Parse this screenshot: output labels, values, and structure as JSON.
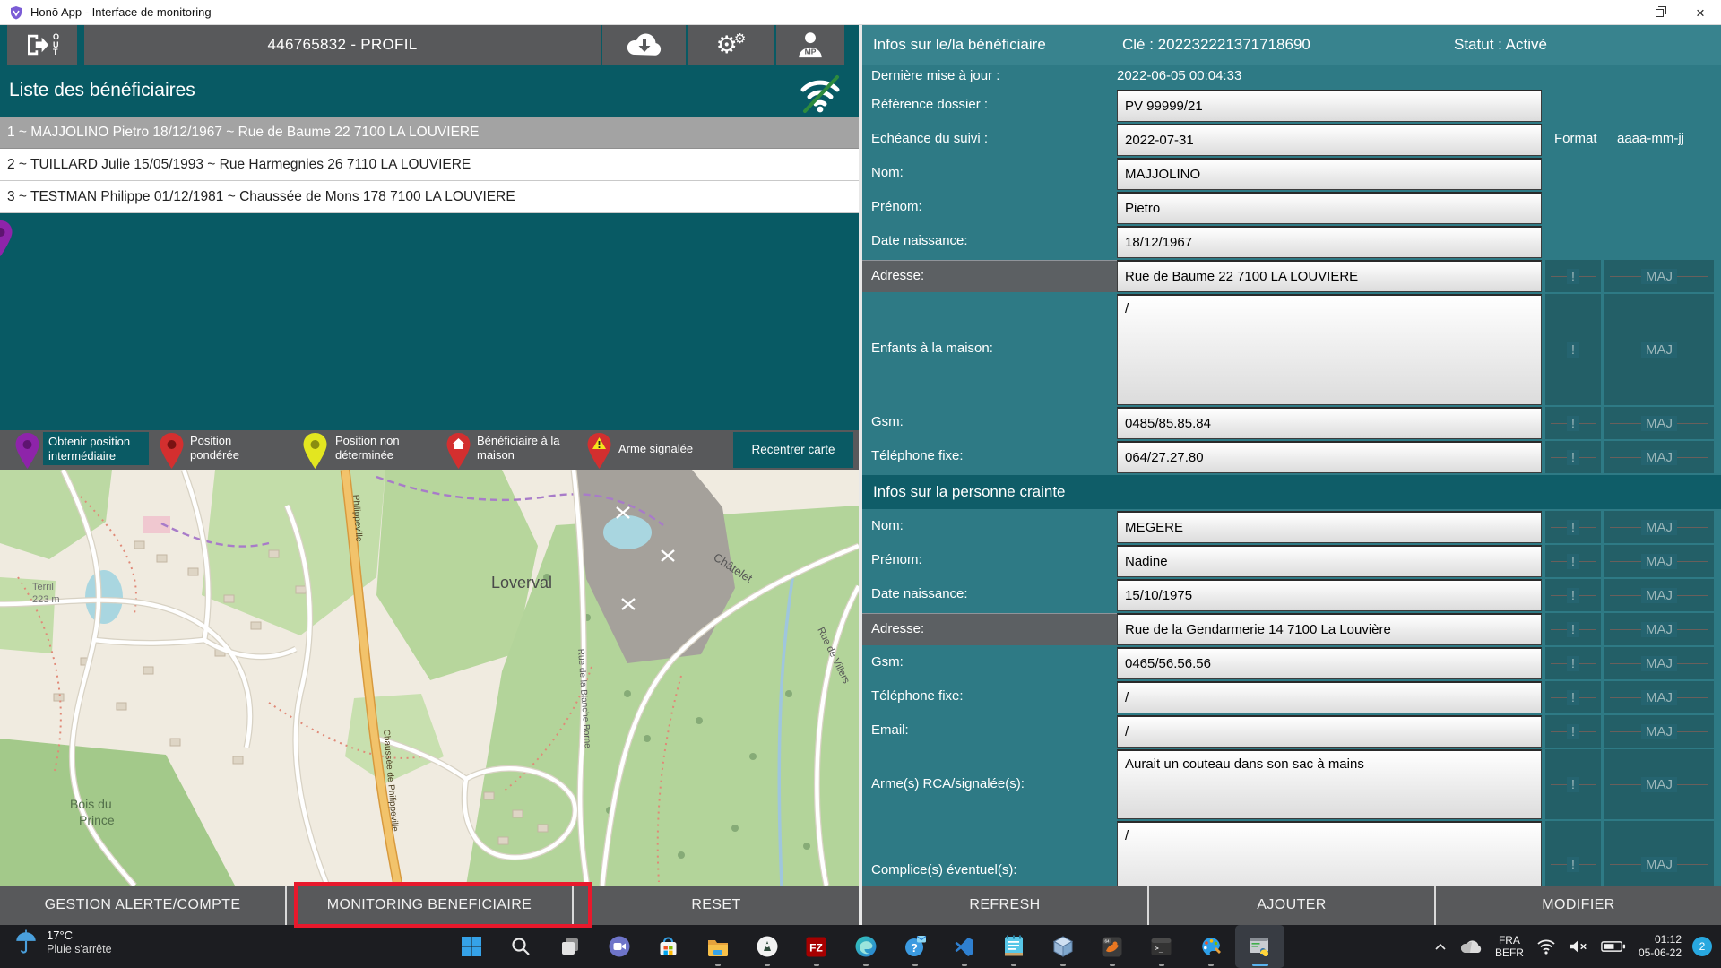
{
  "window": {
    "title": "Honō App - Interface de monitoring"
  },
  "toolbar": {
    "out_label": "OUT",
    "profile_label": "446765832 - PROFIL",
    "person_badge": "MP",
    "icons": [
      "logout-icon",
      "cloud-download-icon",
      "settings-gears-icon",
      "user-mp-icon",
      "wifi-ok-icon"
    ]
  },
  "beneficiaries": {
    "header": "Liste des bénéficiaires",
    "items": [
      "1 ~ MAJJOLINO Pietro 18/12/1967 ~ Rue de Baume 22 7100 LA LOUVIERE",
      "2 ~ TUILLARD Julie 15/05/1993 ~ Rue Harmegnies 26 7110 LA LOUVIERE",
      "3 ~ TESTMAN Philippe 01/12/1981 ~ Chaussée de Mons 178 7100 LA LOUVIERE"
    ]
  },
  "legend": {
    "items": [
      {
        "label": "Obtenir position intermédiaire",
        "pin_color": "#8e24aa"
      },
      {
        "label": "Position pondérée",
        "pin_color": "#d32f2f"
      },
      {
        "label": "Position non déterminée",
        "pin_color": "#e3e620"
      },
      {
        "label": "Bénéficiaire à la maison",
        "pin_color": "#d32f2f"
      },
      {
        "label": "Arme signalée",
        "pin_color": "#d32f2f"
      }
    ],
    "recenter_label": "Recentrer carte"
  },
  "map": {
    "labels": {
      "terril_1": "Terril",
      "terril_2": "223 m",
      "loverval": "Loverval",
      "chatelet": "Châtelet",
      "rue_villers": "Rue de Villers",
      "rue_blanche": "Rue de la Blanche Borne",
      "philippeville": "Philippeville",
      "chaussee": "Chaussée de Philippeville",
      "bois_1": "Bois du",
      "bois_2": "Prince"
    }
  },
  "left_buttons": [
    "GESTION ALERTE/COMPTE",
    "MONITORING BENEFICIAIRE",
    "RESET"
  ],
  "right_buttons": [
    "REFRESH",
    "AJOUTER",
    "MODIFIER"
  ],
  "maj": {
    "alert": "!",
    "update": "MAJ"
  },
  "beneficiary_info": {
    "title": "Infos sur le/la bénéficiaire",
    "key_label": "Clé : 202232221371718690",
    "status_label": "Statut : Activé",
    "format_label": "Format",
    "format_value": "aaaa-mm-jj",
    "rows": [
      {
        "label": "Dernière mise à jour :",
        "value": "2022-06-05 00:04:33"
      },
      {
        "label": "Référence dossier :",
        "value": "PV 99999/21"
      },
      {
        "label": "Echéance du suivi :",
        "value": "2022-07-31"
      },
      {
        "label": "Nom:",
        "value": "MAJJOLINO"
      },
      {
        "label": "Prénom:",
        "value": "Pietro"
      },
      {
        "label": "Date naissance:",
        "value": "18/12/1967"
      },
      {
        "label": "Adresse:",
        "value": "Rue de Baume 22 7100 LA LOUVIERE"
      },
      {
        "label": "Enfants à la maison:",
        "value": "/"
      },
      {
        "label": "Gsm:",
        "value": "0485/85.85.84"
      },
      {
        "label": "Téléphone fixe:",
        "value": "064/27.27.80"
      }
    ]
  },
  "feared_person": {
    "title": "Infos sur la personne crainte",
    "rows": [
      {
        "label": "Nom:",
        "value": "MEGERE"
      },
      {
        "label": "Prénom:",
        "value": "Nadine"
      },
      {
        "label": "Date naissance:",
        "value": "15/10/1975"
      },
      {
        "label": "Adresse:",
        "value": "Rue de la Gendarmerie 14 7100 La Louvière"
      },
      {
        "label": "Gsm:",
        "value": "0465/56.56.56"
      },
      {
        "label": "Téléphone fixe:",
        "value": "/"
      },
      {
        "label": "Email:",
        "value": "/"
      },
      {
        "label": "Arme(s) RCA/signalée(s):",
        "value": "Aurait un couteau dans son sac à mains"
      },
      {
        "label": "Complice(s) éventuel(s):",
        "value": "/"
      }
    ]
  },
  "taskbar": {
    "weather": {
      "temp": "17°C",
      "desc": "Pluie s'arrête"
    },
    "icons": [
      "start-icon",
      "search-icon",
      "task-view-icon",
      "chat-icon",
      "store-icon",
      "explorer-icon",
      "android-app-icon",
      "filezilla-icon",
      "edge-icon",
      "get-help-icon",
      "vscode-icon",
      "notepad-icon",
      "virtualbox-icon",
      "python64-icon",
      "terminal-icon",
      "paint-icon",
      "python-window-icon"
    ],
    "tray": {
      "lang_1": "FRA",
      "lang_2": "BEFR",
      "time": "01:12",
      "date": "05-06-22",
      "badge": "2"
    }
  }
}
